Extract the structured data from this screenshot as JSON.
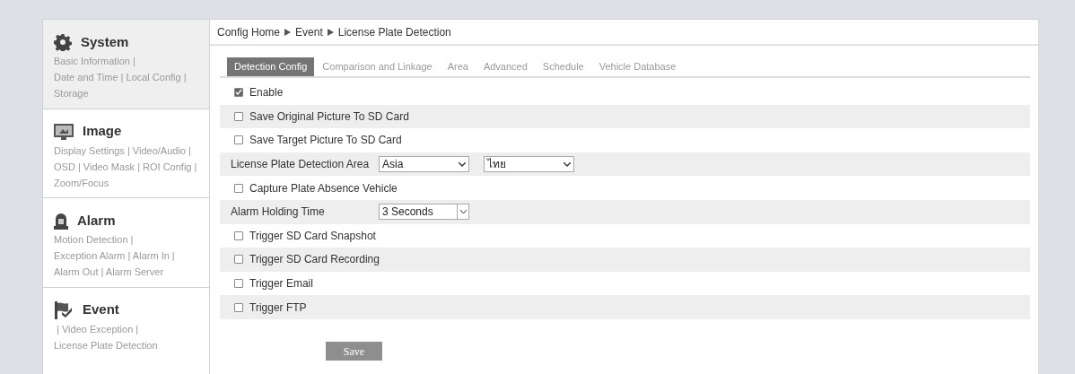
{
  "sidebar": {
    "sections": [
      {
        "title": "System",
        "highlighted": true,
        "links": "Basic Information |\nDate and Time | Local Config |\nStorage"
      },
      {
        "title": "Image",
        "highlighted": false,
        "links": "Display Settings | Video/Audio |\nOSD | Video Mask | ROI Config |\nZoom/Focus"
      },
      {
        "title": "Alarm",
        "highlighted": false,
        "links": "Motion Detection |\nException Alarm | Alarm In |\nAlarm Out | Alarm Server"
      },
      {
        "title": "Event",
        "highlighted": false,
        "links": " | Video Exception |\nLicense Plate Detection"
      }
    ]
  },
  "breadcrumb": [
    "Config Home",
    "Event",
    "License Plate Detection"
  ],
  "tabs": [
    {
      "label": "Detection Config",
      "selected": true
    },
    {
      "label": "Comparison and Linkage",
      "selected": false
    },
    {
      "label": "Area",
      "selected": false
    },
    {
      "label": "Advanced",
      "selected": false
    },
    {
      "label": "Schedule",
      "selected": false
    },
    {
      "label": "Vehicle Database",
      "selected": false
    }
  ],
  "rows": [
    {
      "kind": "checkbox",
      "label": "Enable",
      "checked": true
    },
    {
      "kind": "checkbox",
      "label": "Save Original Picture To SD Card",
      "checked": false
    },
    {
      "kind": "checkbox",
      "label": "Save Target Picture To SD Card",
      "checked": false
    },
    {
      "kind": "select",
      "label": "License Plate Detection Area",
      "selects": [
        "Asia",
        "ไทย"
      ]
    },
    {
      "kind": "checkbox",
      "label": "Capture Plate Absence Vehicle",
      "checked": false
    },
    {
      "kind": "spinselect",
      "label": "Alarm Holding Time",
      "selects": [
        "3 Seconds"
      ]
    },
    {
      "kind": "checkbox",
      "label": "Trigger SD Card Snapshot",
      "checked": false
    },
    {
      "kind": "checkbox",
      "label": "Trigger SD Card Recording",
      "checked": false
    },
    {
      "kind": "checkbox",
      "label": "Trigger Email",
      "checked": false
    },
    {
      "kind": "checkbox",
      "label": "Trigger FTP",
      "checked": false
    }
  ],
  "save_button": "Save"
}
